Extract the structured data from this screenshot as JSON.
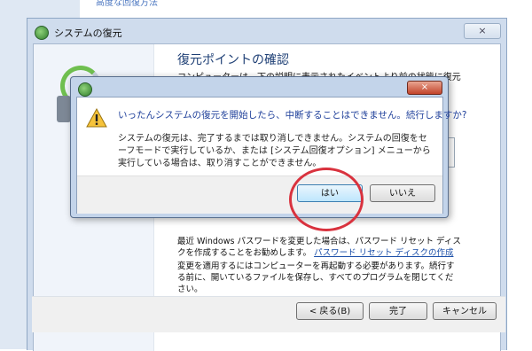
{
  "background": {
    "top_link": "高度な回復方法"
  },
  "wizard": {
    "title": "システムの復元",
    "close_label": "×",
    "heading": "復元ポイントの確認",
    "intro_text": "コンピューターは、下の説明に表示されたイベントより前の状態に復元されます。",
    "password_note": "最近 Windows パスワードを変更した場合は、パスワード リセット ディスクを作成することをお勧めします。",
    "password_link": "パスワード リセット ディスクの作成",
    "restart_note": "変更を適用するにはコンピューターを再起動する必要があります。続行する前に、開いているファイルを保存し、すべてのプログラムを閉じてください。",
    "back_button": "< 戻る(B)",
    "finish_button": "完了",
    "cancel_button": "キャンセル"
  },
  "dialog": {
    "close_label": "×",
    "question": "いったんシステムの復元を開始したら、中断することはできません。続行しますか?",
    "detail": "システムの復元は、完了するまでは取り消しできません。システムの回復をセーフモードで実行しているか、または [システム回復オプション] メニューから実行している場合は、取り消すことができません。",
    "yes_button": "はい",
    "no_button": "いいえ"
  },
  "colors": {
    "heading": "#1e3f75",
    "question": "#1e3f9a",
    "highlight": "#d9323e"
  },
  "icons": {
    "window": "system-restore-icon",
    "dialog": "system-restore-icon",
    "warning": "warning-icon"
  }
}
